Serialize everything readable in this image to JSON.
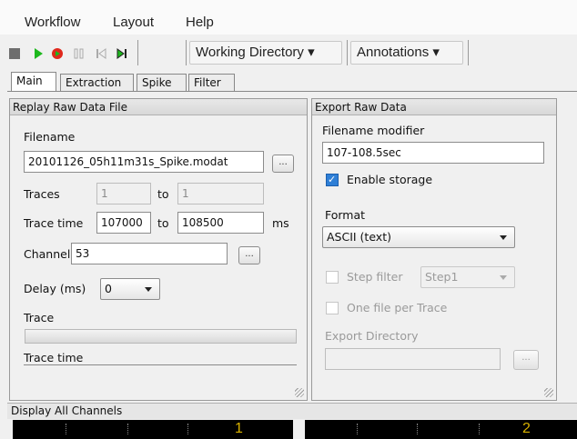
{
  "menubar": {
    "items": [
      "Workflow",
      "Layout",
      "Help"
    ]
  },
  "toolbar": {
    "icons": [
      "stop-icon",
      "play-icon",
      "record-icon",
      "pause-icon",
      "skip-back-icon",
      "skip-forward-icon"
    ],
    "working_directory": "Working Directory",
    "annotations": "Annotations"
  },
  "tabs": [
    "Main",
    "Extraction",
    "Spike",
    "Filter"
  ],
  "replay": {
    "title": "Replay Raw Data File",
    "filename_label": "Filename",
    "filename_value": "20101126_05h11m31s_Spike.modat",
    "browse_label": "...",
    "traces_label": "Traces",
    "traces_from": "1",
    "to_label": "to",
    "traces_to": "1",
    "trace_time_label": "Trace time",
    "trace_time_from": "107000",
    "trace_time_to": "108500",
    "ms_label": "ms",
    "channels_label": "Channels",
    "channels_value": "53",
    "delay_label": "Delay (ms)",
    "delay_value": "0",
    "trace_label": "Trace",
    "trace_progress": 0,
    "trace_time_footer": "Trace time"
  },
  "export": {
    "title": "Export Raw Data",
    "modifier_label": "Filename modifier",
    "modifier_value": "107-108.5sec",
    "enable_storage_label": "Enable storage",
    "enable_storage_checked": true,
    "format_label": "Format",
    "format_value": "ASCII (text)",
    "step_filter_label": "Step filter",
    "step_filter_value": "Step1",
    "step_filter_checked": false,
    "one_file_label": "One file per Trace",
    "one_file_checked": false,
    "export_dir_label": "Export Directory",
    "export_dir_value": "",
    "browse_label": "..."
  },
  "display": {
    "title": "Display All Channels",
    "channels": [
      "1",
      "2"
    ]
  },
  "colors": {
    "play": "#1db81d",
    "record": "#e0281c",
    "checkbox": "#2f7fd6",
    "channel_label": "#d9b200"
  }
}
